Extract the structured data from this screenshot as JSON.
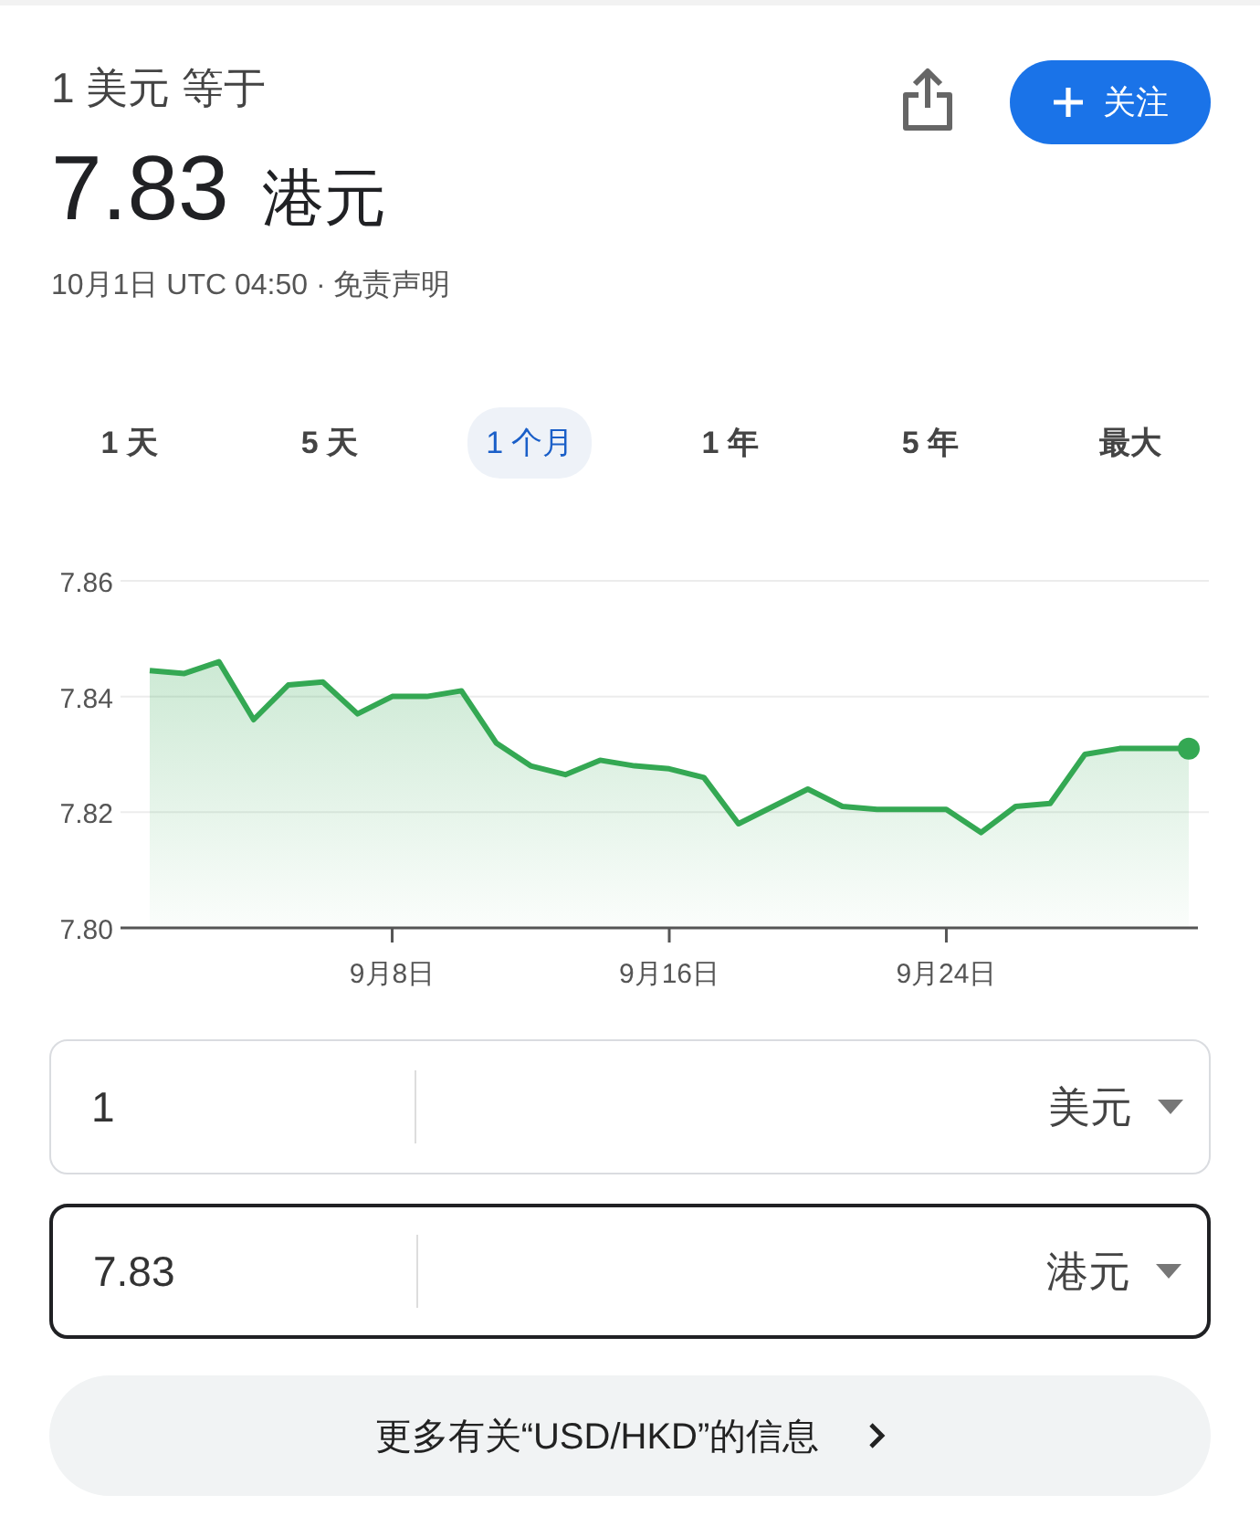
{
  "header": {
    "base_label": "1 美元 等于",
    "rate": "7.83",
    "quote_currency": "港元",
    "timestamp": "10月1日 UTC 04:50 · ",
    "disclaimer": "免责声明",
    "follow_button": "关注"
  },
  "ranges": [
    {
      "label": "1 天",
      "selected": false
    },
    {
      "label": "5 天",
      "selected": false
    },
    {
      "label": "1 个月",
      "selected": true
    },
    {
      "label": "1 年",
      "selected": false
    },
    {
      "label": "5 年",
      "selected": false
    },
    {
      "label": "最大",
      "selected": false
    }
  ],
  "chart_data": {
    "type": "area",
    "categories": [
      null,
      null,
      null,
      null,
      null,
      null,
      null,
      "9月8日",
      null,
      null,
      null,
      null,
      null,
      null,
      null,
      "9月16日",
      null,
      null,
      null,
      null,
      null,
      null,
      null,
      "9月24日",
      null,
      null,
      null,
      null,
      null,
      null,
      null
    ],
    "series": [
      {
        "color": "#34a853",
        "values": [
          7.8445,
          7.844,
          7.846,
          7.836,
          7.842,
          7.8425,
          7.837,
          7.84,
          7.84,
          7.841,
          7.832,
          7.828,
          7.8265,
          7.829,
          7.828,
          7.8275,
          7.826,
          7.818,
          7.821,
          7.824,
          7.821,
          7.8205,
          7.8205,
          7.8205,
          7.8165,
          7.821,
          7.8215,
          7.83,
          7.831,
          7.831,
          7.831
        ]
      }
    ],
    "ylim": [
      7.8,
      7.86
    ],
    "yticks": [
      {
        "value": 7.8,
        "label": "7.80"
      },
      {
        "value": 7.82,
        "label": "7.82"
      },
      {
        "value": 7.84,
        "label": "7.84"
      },
      {
        "value": 7.86,
        "label": "7.86"
      }
    ]
  },
  "converter": [
    {
      "amount": "1",
      "currency": "美元",
      "focused": false
    },
    {
      "amount": "7.83",
      "currency": "港元",
      "focused": true
    }
  ],
  "more_info": "更多有关“USD/HKD”的信息"
}
